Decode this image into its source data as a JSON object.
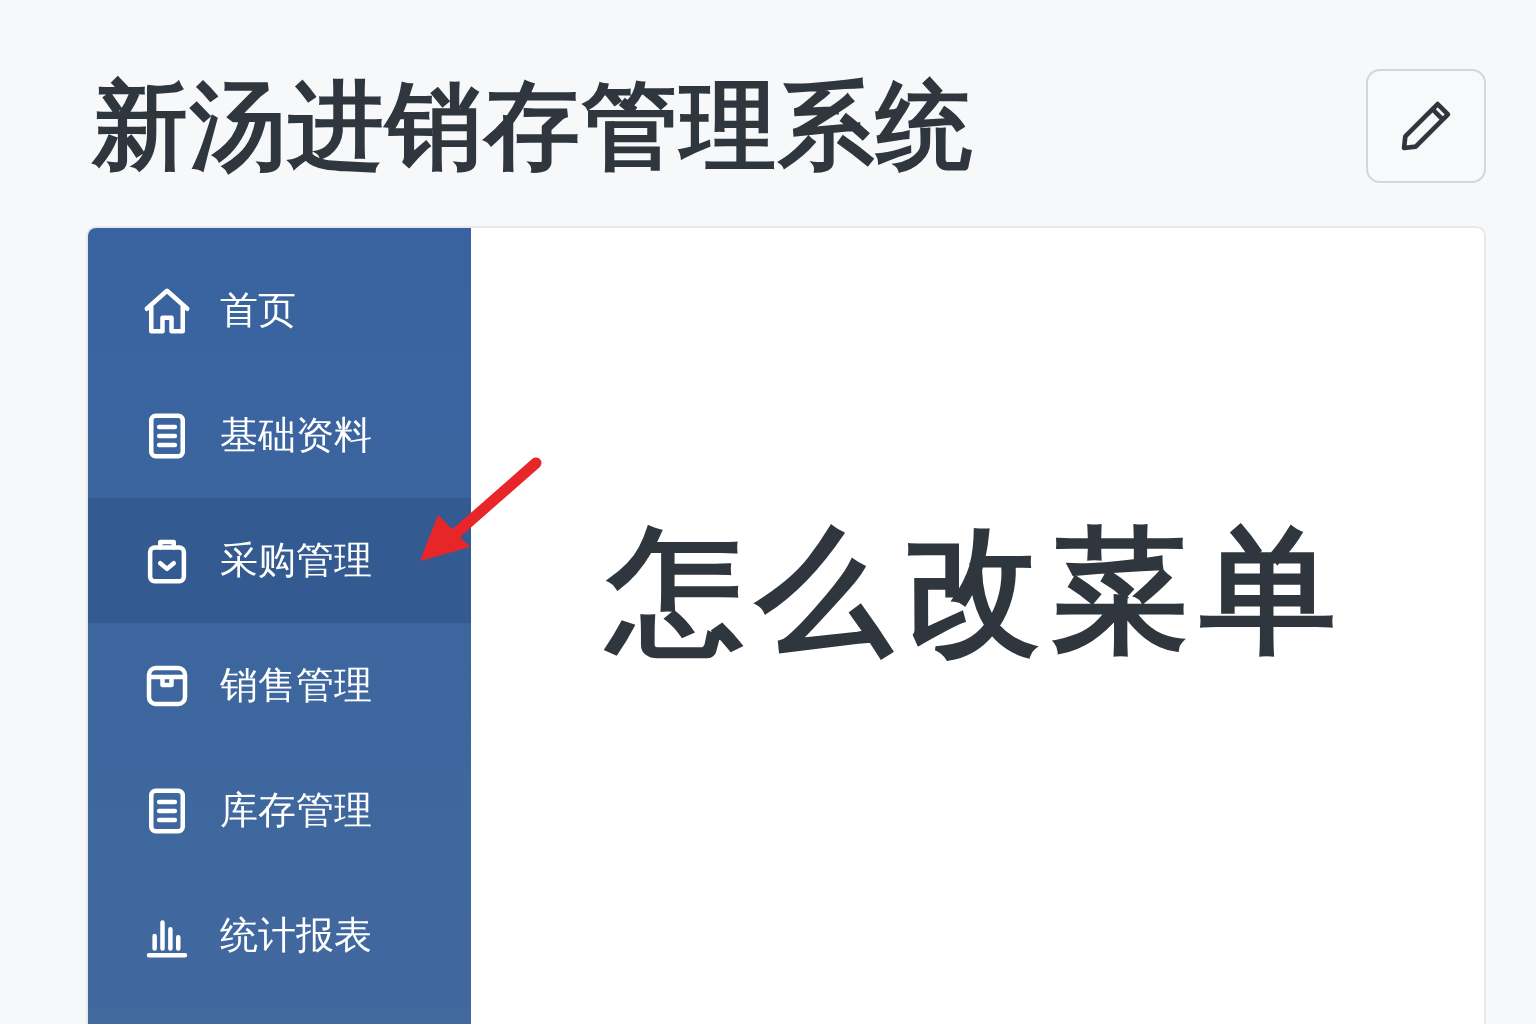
{
  "header": {
    "title": "新汤进销存管理系统"
  },
  "sidebar": {
    "items": [
      {
        "label": "首页",
        "selected": false
      },
      {
        "label": "基础资料",
        "selected": false
      },
      {
        "label": "采购管理",
        "selected": true
      },
      {
        "label": "销售管理",
        "selected": false
      },
      {
        "label": "库存管理",
        "selected": false
      },
      {
        "label": "统计报表",
        "selected": false
      }
    ]
  },
  "content": {
    "heading": "怎么改菜单"
  }
}
